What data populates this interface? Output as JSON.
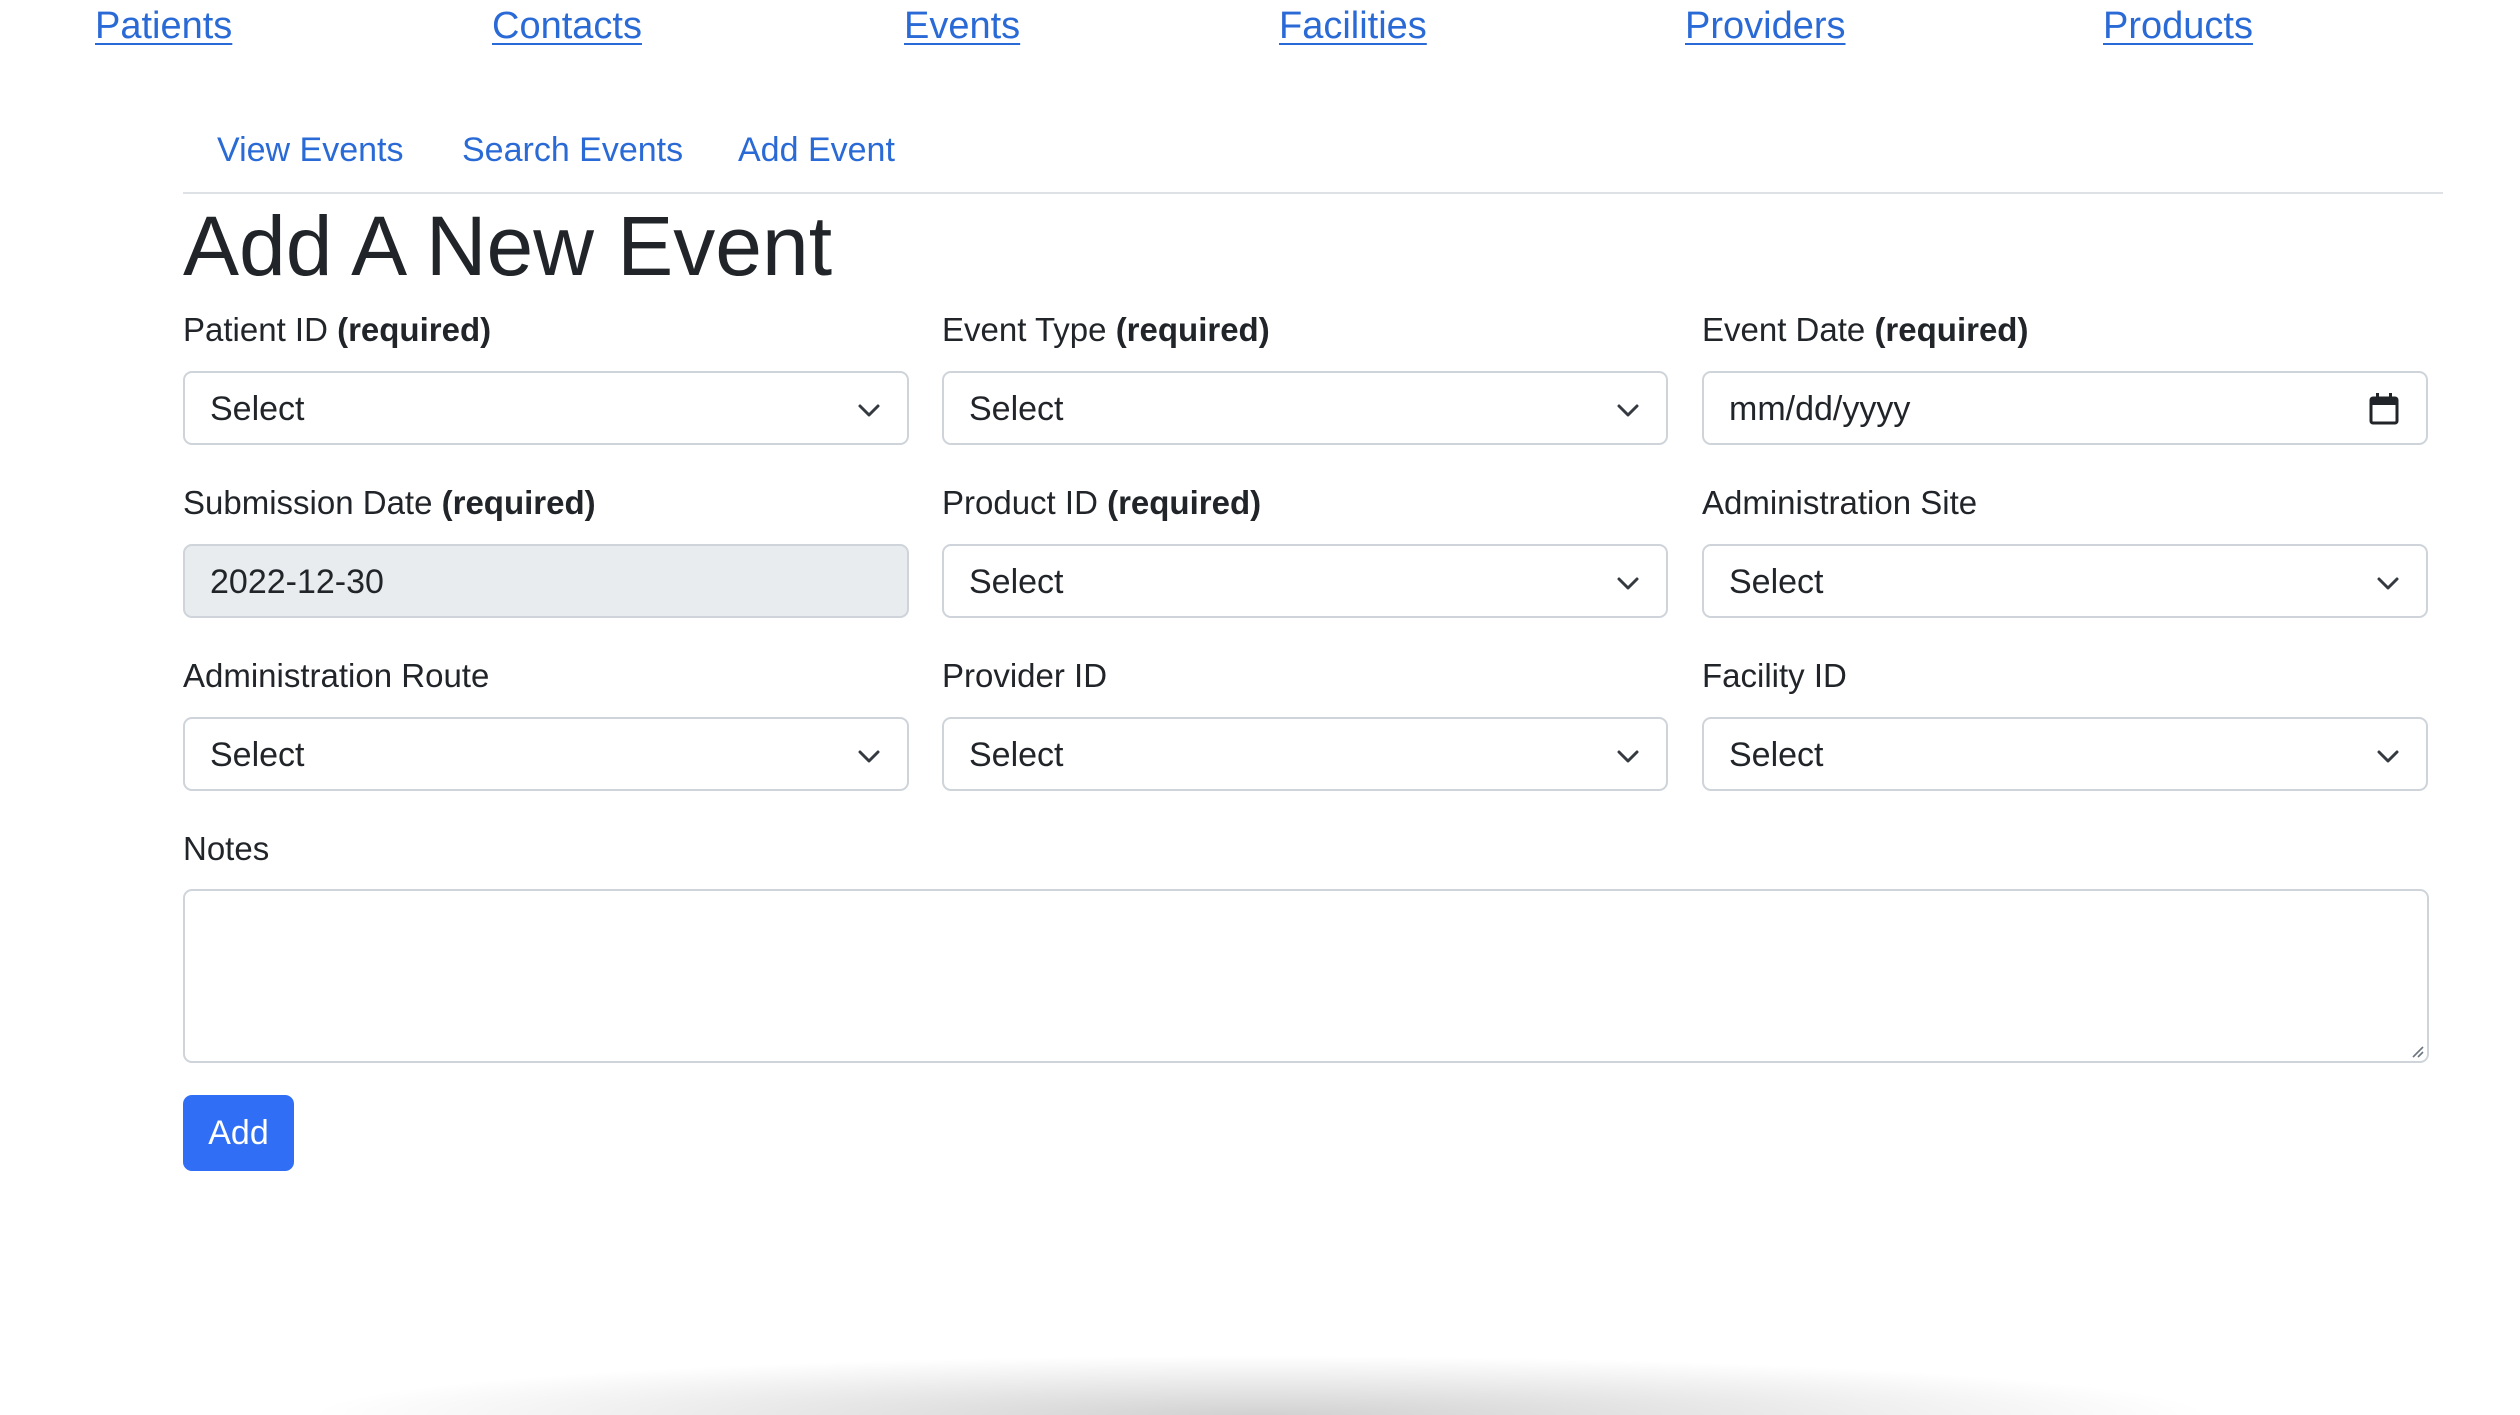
{
  "top_nav": {
    "patients": "Patients",
    "contacts": "Contacts",
    "events": "Events",
    "facilities": "Facilities",
    "providers": "Providers",
    "products": "Products"
  },
  "sub_nav": {
    "view_events": "View Events",
    "search_events": "Search Events",
    "add_event": "Add Event"
  },
  "page_title": "Add A New Event",
  "required_marker": "(required)",
  "form": {
    "patient_id": {
      "label": "Patient ID",
      "value": "Select"
    },
    "event_type": {
      "label": "Event Type",
      "value": "Select"
    },
    "event_date": {
      "label": "Event Date",
      "placeholder": "mm/dd/yyyy"
    },
    "submission_date": {
      "label": "Submission Date",
      "value": "2022-12-30"
    },
    "product_id": {
      "label": "Product ID",
      "value": "Select"
    },
    "administration_site": {
      "label": "Administration Site",
      "value": "Select"
    },
    "administration_route": {
      "label": "Administration Route",
      "value": "Select"
    },
    "provider_id": {
      "label": "Provider ID",
      "value": "Select"
    },
    "facility_id": {
      "label": "Facility ID",
      "value": "Select"
    },
    "notes": {
      "label": "Notes",
      "value": ""
    }
  },
  "submit_label": "Add",
  "colors": {
    "link": "#2a6ad6",
    "primary_button": "#2f6ef5",
    "border": "#ced4da",
    "disabled_bg": "#e9ecef",
    "text": "#212529"
  },
  "icons": {
    "select_arrow": "chevron-down-icon",
    "date_picker": "calendar-icon",
    "textarea_resize": "resize-grip-icon"
  }
}
